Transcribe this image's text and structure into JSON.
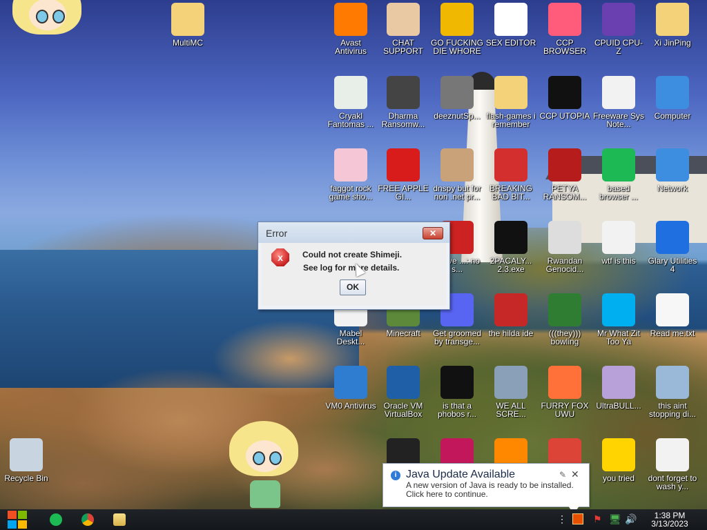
{
  "desktop": {
    "icons": [
      {
        "label": "MultiMC",
        "icon": "folder-icon",
        "color": "#f3d27a"
      },
      {
        "label": "Avast Antivirus",
        "icon": "avast-icon",
        "color": "#ff7a00"
      },
      {
        "label": "CHAT SUPPORT",
        "icon": "doctor-icon",
        "color": "#e8c9a4"
      },
      {
        "label": "GO FUCKING DIE WHORE",
        "icon": "de-icon",
        "color": "#f0b800"
      },
      {
        "label": "SEX EDITOR",
        "icon": "hxd-icon",
        "color": "#ffffff"
      },
      {
        "label": "CCP BROWSER",
        "icon": "chromium-icon",
        "color": "#ff5b7a"
      },
      {
        "label": "CPUID CPU-Z",
        "icon": "cpuz-icon",
        "color": "#6a3fb0"
      },
      {
        "label": "Xi JinPing",
        "icon": "user-folder-icon",
        "color": "#f3d27a"
      },
      {
        "label": "Cryakl Fantomas ...",
        "icon": "window-icon",
        "color": "#e8efe8"
      },
      {
        "label": "Dharma Ransomw...",
        "icon": "skull-icon",
        "color": "#444444"
      },
      {
        "label": "deeznutSp...",
        "icon": "stack-icon",
        "color": "#777777"
      },
      {
        "label": "flash-games i remember",
        "icon": "folder-icon",
        "color": "#f3d27a"
      },
      {
        "label": "CCP UTOPIA",
        "icon": "utopia-icon",
        "color": "#111111"
      },
      {
        "label": "Freeware Sys Note...",
        "icon": "document-icon",
        "color": "#f2f2f2"
      },
      {
        "label": "Computer",
        "icon": "computer-icon",
        "color": "#3d8de0"
      },
      {
        "label": "faggot rock game sho...",
        "icon": "rock-icon",
        "color": "#f4c6d6"
      },
      {
        "label": "FREE APPLE GI...",
        "icon": "apple-icon",
        "color": "#d81b1b"
      },
      {
        "label": "dnspy but for non .net pr...",
        "icon": "portrait-icon",
        "color": "#c9a27a"
      },
      {
        "label": "BREAKING BAD BIT...",
        "icon": "angry-bird-icon",
        "color": "#d32f2f"
      },
      {
        "label": "PETYA RANSOM...",
        "icon": "petya-skull-icon",
        "color": "#b71c1c"
      },
      {
        "label": "based browser ...",
        "icon": "chat-bubble-icon",
        "color": "#1db954"
      },
      {
        "label": "Network",
        "icon": "network-icon",
        "color": "#3d8de0"
      },
      {
        "label": "above ...: no s...",
        "icon": "app-icon",
        "color": "#cc2222"
      },
      {
        "label": "2PACALY... 2.3.exe",
        "icon": "terminal-icon",
        "color": "#111111"
      },
      {
        "label": "Rwandan Genocid...",
        "icon": "meme-icon",
        "color": "#dddddd"
      },
      {
        "label": "wtf is this",
        "icon": "calendar-doc-icon",
        "color": "#f2f2f2"
      },
      {
        "label": "Glary Utilities 4",
        "icon": "glary-icon",
        "color": "#1f6fe0"
      },
      {
        "label": "Mabel Deskt...",
        "icon": "mabel-icon",
        "color": "#f2f2f2"
      },
      {
        "label": "Minecraft",
        "icon": "minecraft-icon",
        "color": "#5c8a3a"
      },
      {
        "label": "Get groomed by transge...",
        "icon": "discord-icon",
        "color": "#5865f2"
      },
      {
        "label": "the hilda ide",
        "icon": "devcpp-icon",
        "color": "#c62828"
      },
      {
        "label": "(((they))) bowling",
        "icon": "bowling-icon",
        "color": "#2e7d32"
      },
      {
        "label": "Mr What Zit Too Ya",
        "icon": "skype-icon",
        "color": "#00aff0"
      },
      {
        "label": "Read me.txt",
        "icon": "text-file-icon",
        "color": "#f7f7f7"
      },
      {
        "label": "VM0 Antivirus",
        "icon": "shield-icon",
        "color": "#2e7dd1"
      },
      {
        "label": "Oracle VM VirtualBox",
        "icon": "virtualbox-icon",
        "color": "#1f5fa8"
      },
      {
        "label": "is that a phobos r...",
        "icon": "icq-icon",
        "color": "#111111"
      },
      {
        "label": "WE ALL SCRE...",
        "icon": "pc-icon",
        "color": "#8aa0b8"
      },
      {
        "label": "FURRY FOX UWU",
        "icon": "firefox-icon",
        "color": "#ff7139"
      },
      {
        "label": "UltraBULL...",
        "icon": "disc-icon",
        "color": "#b8a0d8"
      },
      {
        "label": "this aint stopping di...",
        "icon": "monitor-icon",
        "color": "#9ab8d8"
      },
      {
        "label": "",
        "icon": "skull-app-icon",
        "color": "#222222"
      },
      {
        "label": "",
        "icon": "media-icon",
        "color": "#c2185b"
      },
      {
        "label": "",
        "icon": "vlc-icon",
        "color": "#ff8800"
      },
      {
        "label": "",
        "icon": "chrome-icon",
        "color": "#db4437"
      },
      {
        "label": "you tried",
        "icon": "star-icon",
        "color": "#ffd400"
      },
      {
        "label": "dont forget to wash y...",
        "icon": "calendar-doc-icon",
        "color": "#f2f2f2"
      },
      {
        "label": "Recycle Bin",
        "icon": "recycle-bin-icon",
        "color": "#c8d4e0"
      }
    ]
  },
  "error_dialog": {
    "title": "Error",
    "close_label": "✕",
    "icon_label": "x",
    "message_line1": "Could not create Shimeji.",
    "message_line2": "See log for more details.",
    "ok_label": "OK"
  },
  "java_notification": {
    "title": "Java Update Available",
    "message_line1": "A new version of Java is ready to be installed.",
    "message_line2": "Click here to continue.",
    "close_label": "✕",
    "tools_label": "✎"
  },
  "taskbar": {
    "clock_time": "1:38 PM",
    "clock_date": "3/13/2023",
    "pinned": [
      "chat-app-icon",
      "chrome-icon",
      "file-explorer-icon"
    ],
    "tray": [
      "overflow-icon",
      "java-tray-icon",
      "flag-icon",
      "network-tray-icon",
      "volume-icon"
    ]
  }
}
